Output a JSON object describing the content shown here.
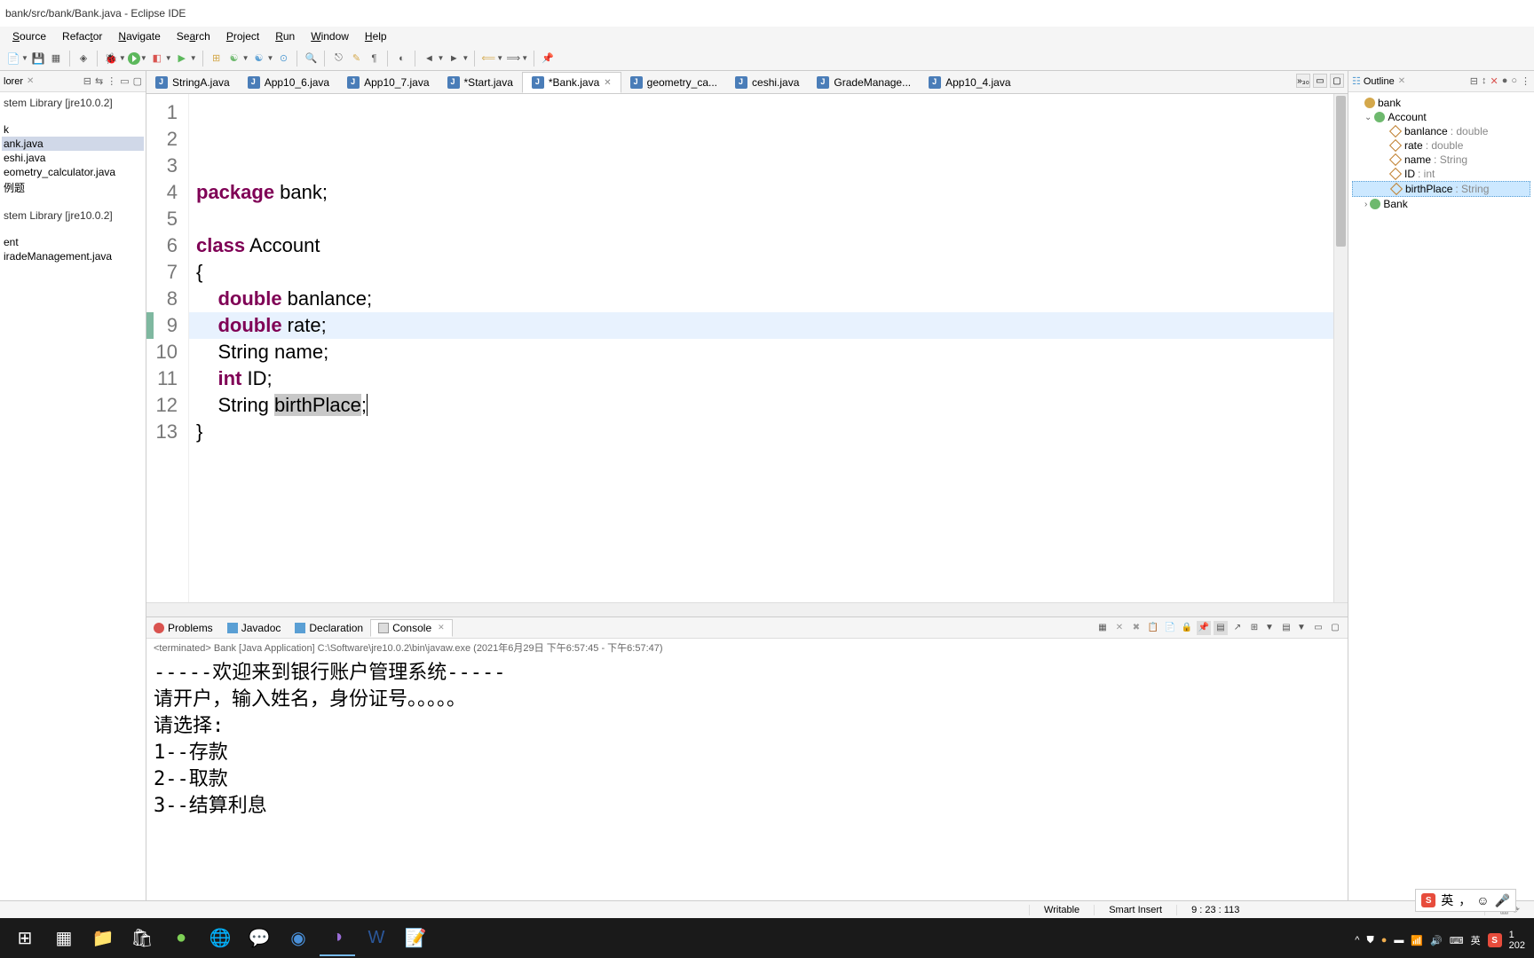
{
  "titlebar": "bank/src/bank/Bank.java - Eclipse IDE",
  "menu": {
    "file_hidden": "",
    "source": "Source",
    "refactor": "Refactor",
    "navigate": "Navigate",
    "search": "Search",
    "project": "Project",
    "run": "Run",
    "window": "Window",
    "help": "Help"
  },
  "explorer": {
    "title": "lorer",
    "items": [
      {
        "label": "stem Library [jre10.0.2]"
      },
      {
        "label": "k"
      },
      {
        "label": "ank.java",
        "selected": true
      },
      {
        "label": "eshi.java"
      },
      {
        "label": "eometry_calculator.java"
      },
      {
        "label": "例题"
      },
      {
        "label": "stem Library [jre10.0.2]"
      },
      {
        "label": "ent"
      },
      {
        "label": "iradeManagement.java"
      }
    ]
  },
  "tabs": [
    {
      "label": "StringA.java"
    },
    {
      "label": "App10_6.java"
    },
    {
      "label": "App10_7.java"
    },
    {
      "label": "*Start.java"
    },
    {
      "label": "*Bank.java",
      "active": true
    },
    {
      "label": "geometry_ca..."
    },
    {
      "label": "ceshi.java"
    },
    {
      "label": "GradeManage..."
    },
    {
      "label": "App10_4.java"
    }
  ],
  "tabs_more": "»₃₀",
  "code": {
    "lines": [
      {
        "n": "1",
        "pre": "",
        "kw": "package",
        "rest": " bank;"
      },
      {
        "n": "2",
        "pre": "",
        "kw": "",
        "rest": ""
      },
      {
        "n": "3",
        "pre": "",
        "kw": "class",
        "rest": " Account"
      },
      {
        "n": "4",
        "pre": "{",
        "kw": "",
        "rest": ""
      },
      {
        "n": "5",
        "pre": "    ",
        "kw": "double",
        "rest": " banlance;"
      },
      {
        "n": "6",
        "pre": "    ",
        "kw": "double",
        "rest": " rate;"
      },
      {
        "n": "7",
        "pre": "    String name;",
        "kw": "",
        "rest": ""
      },
      {
        "n": "8",
        "pre": "    ",
        "kw": "int",
        "rest": " ID;"
      },
      {
        "n": "9",
        "pre": "    String ",
        "hl": "birthPlace",
        "rest2": ";",
        "current": true
      },
      {
        "n": "10",
        "pre": "}",
        "kw": "",
        "rest": ""
      },
      {
        "n": "11",
        "pre": "",
        "kw": "",
        "rest": ""
      },
      {
        "n": "12",
        "pre": "",
        "kw": "",
        "rest": ""
      },
      {
        "n": "13",
        "pre": "",
        "kw": "",
        "rest": ""
      }
    ]
  },
  "bottom_tabs": {
    "problems": "Problems",
    "javadoc": "Javadoc",
    "declaration": "Declaration",
    "console": "Console"
  },
  "terminated": "<terminated> Bank [Java Application] C:\\Software\\jre10.0.2\\bin\\javaw.exe  (2021年6月29日 下午6:57:45 - 下午6:57:47)",
  "console": "-----欢迎来到银行账户管理系统-----\n请开户，输入姓名，身份证号。。。。。\n请选择:\n1--存款\n2--取款\n3--结算利息",
  "outline": {
    "title": "Outline",
    "items": [
      {
        "label": "bank",
        "type": "",
        "icon": "pkg",
        "indent": 1
      },
      {
        "label": "Account",
        "type": "",
        "icon": "class",
        "indent": 1,
        "expanded": true
      },
      {
        "label": "banlance",
        "type": " : double",
        "icon": "field",
        "indent": 2
      },
      {
        "label": "rate",
        "type": " : double",
        "icon": "field",
        "indent": 2
      },
      {
        "label": "name",
        "type": " : String",
        "icon": "field",
        "indent": 2
      },
      {
        "label": "ID",
        "type": " : int",
        "icon": "field",
        "indent": 2
      },
      {
        "label": "birthPlace",
        "type": " : String",
        "icon": "field",
        "indent": 2,
        "selected": true
      },
      {
        "label": "Bank",
        "type": "",
        "icon": "class",
        "indent": 1
      }
    ]
  },
  "status": {
    "writable": "Writable",
    "insert": "Smart Insert",
    "pos": "9 : 23 : 113"
  },
  "ime": {
    "label": "英",
    "punct": "，",
    "emoji": "☺"
  },
  "tray": {
    "time": "1",
    "date": "202",
    "lang": "英"
  }
}
